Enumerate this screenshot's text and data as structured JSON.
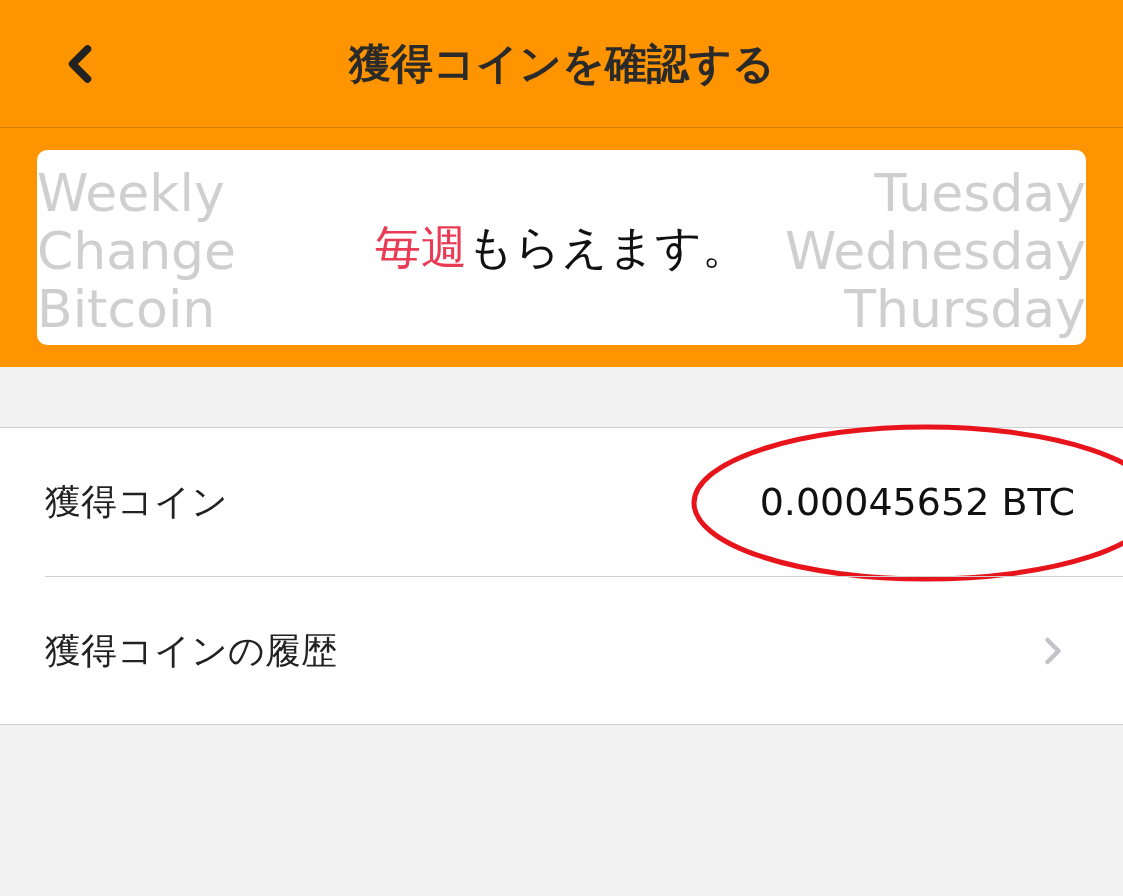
{
  "header": {
    "title": "獲得コインを確認する"
  },
  "banner": {
    "highlight": "毎週",
    "message": "もらえます。",
    "background_left": [
      "Weekly",
      "Change",
      "Bitcoin"
    ],
    "background_right": [
      "Tuesday",
      "Wednesday",
      "Thursday"
    ]
  },
  "rows": [
    {
      "kind": "value",
      "label": "獲得コイン",
      "value": "0.00045652 BTC",
      "circled": true
    },
    {
      "kind": "link",
      "label": "獲得コインの履歴"
    }
  ]
}
